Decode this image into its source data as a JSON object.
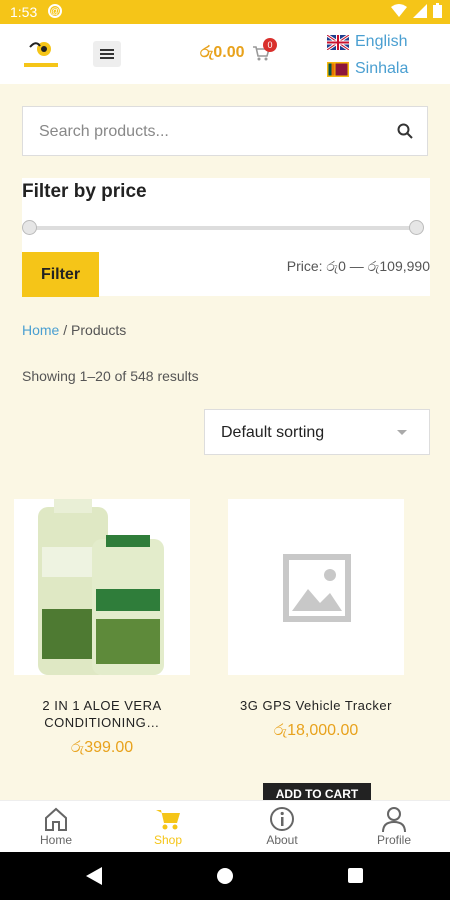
{
  "status_bar": {
    "time": "1:53"
  },
  "header": {
    "cart_total": "රු0.00",
    "cart_count": "0",
    "languages": [
      {
        "label": "English"
      },
      {
        "label": "Sinhala"
      }
    ]
  },
  "search": {
    "placeholder": "Search products..."
  },
  "filter": {
    "title": "Filter by price",
    "button_label": "Filter",
    "price_range": "Price: රු0 — රු109,990",
    "range_min": 0,
    "range_max": 109990
  },
  "breadcrumb": {
    "home": "Home",
    "separator": " / ",
    "current": "Products"
  },
  "results_text": "Showing 1–20 of 548 results",
  "sort": {
    "selected": "Default sorting"
  },
  "products": [
    {
      "name": "2 IN 1 ALOE VERA CONDITIONING…",
      "price": "රු399.00"
    },
    {
      "name": "3G GPS Vehicle Tracker",
      "price": "රු18,000.00"
    }
  ],
  "add_to_cart_label": "ADD TO CART",
  "bottom_nav": [
    {
      "label": "Home",
      "icon": "home-icon"
    },
    {
      "label": "Shop",
      "icon": "cart-icon"
    },
    {
      "label": "About",
      "icon": "info-icon"
    },
    {
      "label": "Profile",
      "icon": "user-icon"
    }
  ],
  "colors": {
    "accent": "#f5c518",
    "price": "#e8a21c",
    "link": "#4a9fd1",
    "background": "#fbf7e4"
  }
}
